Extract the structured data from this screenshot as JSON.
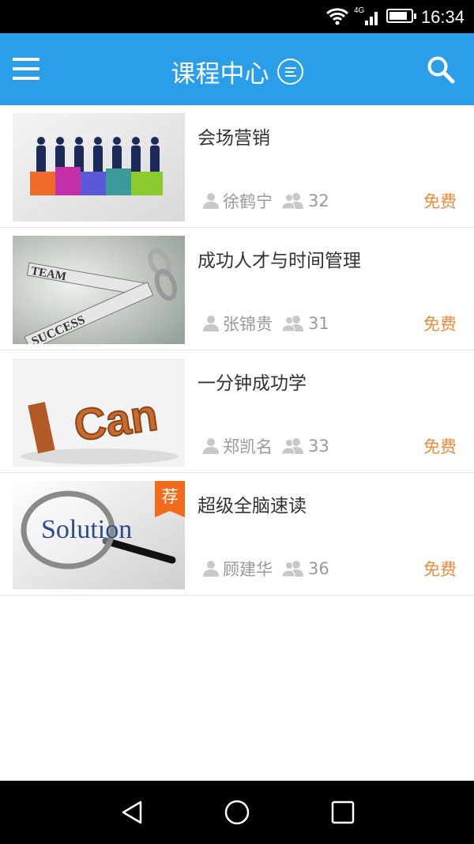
{
  "status_bar": {
    "time": "16:34",
    "network": "4G"
  },
  "app_bar": {
    "title": "课程中心"
  },
  "courses": [
    {
      "title": "会场营销",
      "teacher": "徐鹤宁",
      "students": "32",
      "price": "免费",
      "recommended": false
    },
    {
      "title": "成功人才与时间管理",
      "teacher": "张锦贵",
      "students": "31",
      "price": "免费",
      "recommended": false
    },
    {
      "title": "一分钟成功学",
      "teacher": "郑凯名",
      "students": "33",
      "price": "免费",
      "recommended": false
    },
    {
      "title": "超级全脑速读",
      "teacher": "顾建华",
      "students": "36",
      "price": "免费",
      "recommended": true,
      "badge": "荐"
    }
  ],
  "thumbnails": {
    "team_success": [
      "TEAM",
      "SUCCESS"
    ],
    "i_can": [
      "I",
      "Can"
    ],
    "solution": "Solution"
  },
  "colors": {
    "app_bar": "#2a9ee8",
    "price": "#f08a3c",
    "badge": "#f26b1d"
  }
}
